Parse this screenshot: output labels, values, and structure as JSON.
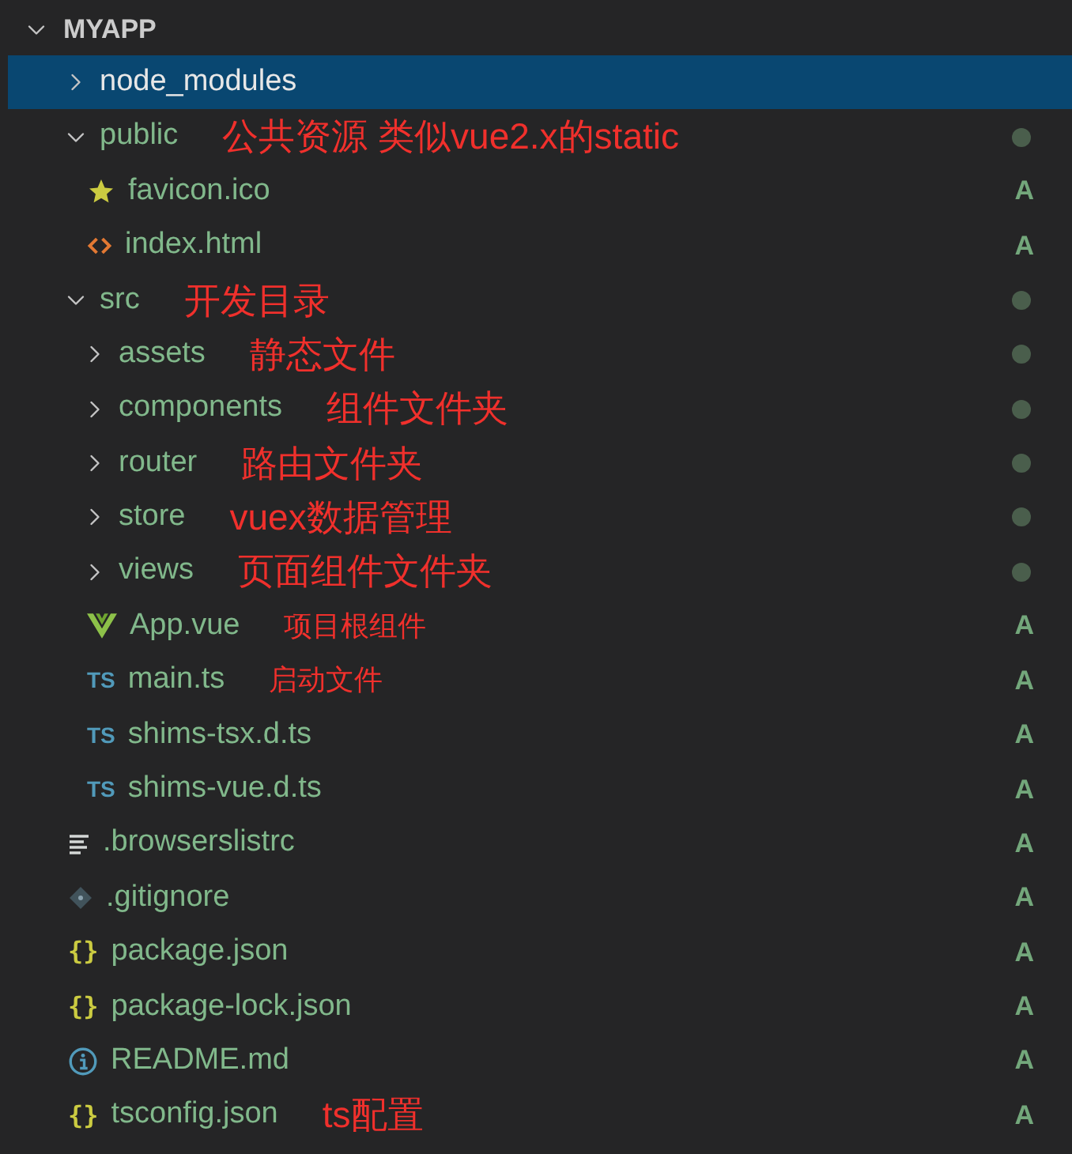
{
  "explorer": {
    "title": "MYAPP",
    "expanded": true,
    "items": [
      {
        "name": "node_modules",
        "kind": "folder",
        "expanded": false,
        "selected": true,
        "dot": false
      },
      {
        "name": "public",
        "kind": "folder",
        "expanded": true,
        "selected": false,
        "dot": true,
        "note": {
          "text": "公共资源 类似vue2.x的static",
          "kind": "large"
        },
        "children": [
          {
            "name": "favicon.ico",
            "kind": "star",
            "selected": false,
            "badge": "A"
          },
          {
            "name": "index.html",
            "kind": "html",
            "selected": false,
            "badge": "A"
          }
        ]
      },
      {
        "name": "src",
        "kind": "folder",
        "expanded": true,
        "selected": false,
        "dot": true,
        "note": {
          "text": "开发目录",
          "kind": "large"
        },
        "children": [
          {
            "name": "assets",
            "kind": "folder",
            "expanded": false,
            "selected": false,
            "dot": true,
            "note": {
              "text": "静态文件",
              "kind": "large"
            }
          },
          {
            "name": "components",
            "kind": "folder",
            "expanded": false,
            "selected": false,
            "dot": true,
            "note": {
              "text": "组件文件夹",
              "kind": "large"
            }
          },
          {
            "name": "router",
            "kind": "folder",
            "expanded": false,
            "selected": false,
            "dot": true,
            "note": {
              "text": "路由文件夹",
              "kind": "large"
            }
          },
          {
            "name": "store",
            "kind": "folder",
            "expanded": false,
            "selected": false,
            "dot": true,
            "note": {
              "text": "vuex数据管理",
              "kind": "large"
            }
          },
          {
            "name": "views",
            "kind": "folder",
            "expanded": false,
            "selected": false,
            "dot": true,
            "note": {
              "text": "页面组件文件夹",
              "kind": "large"
            }
          },
          {
            "name": "App.vue",
            "kind": "vue",
            "selected": false,
            "badge": "A",
            "note": {
              "text": "项目根组件",
              "kind": "small"
            }
          },
          {
            "name": "main.ts",
            "kind": "ts",
            "icon_label": "TS",
            "selected": false,
            "badge": "A",
            "note": {
              "text": "启动文件",
              "kind": "small"
            }
          },
          {
            "name": "shims-tsx.d.ts",
            "kind": "ts",
            "icon_label": "TS",
            "selected": false,
            "badge": "A"
          },
          {
            "name": "shims-vue.d.ts",
            "kind": "ts",
            "icon_label": "TS",
            "selected": false,
            "badge": "A"
          }
        ]
      },
      {
        "name": ".browserslistrc",
        "kind": "lines",
        "selected": false,
        "badge": "A"
      },
      {
        "name": ".gitignore",
        "kind": "git",
        "selected": false,
        "badge": "A"
      },
      {
        "name": "package.json",
        "kind": "json",
        "icon_label": "{}",
        "selected": false,
        "badge": "A"
      },
      {
        "name": "package-lock.json",
        "kind": "json",
        "icon_label": "{}",
        "selected": false,
        "badge": "A"
      },
      {
        "name": "README.md",
        "kind": "info",
        "selected": false,
        "badge": "A"
      },
      {
        "name": "tsconfig.json",
        "kind": "json",
        "icon_label": "{}",
        "selected": false,
        "badge": "A",
        "note": {
          "text": "ts配置",
          "kind": "large"
        }
      }
    ]
  }
}
